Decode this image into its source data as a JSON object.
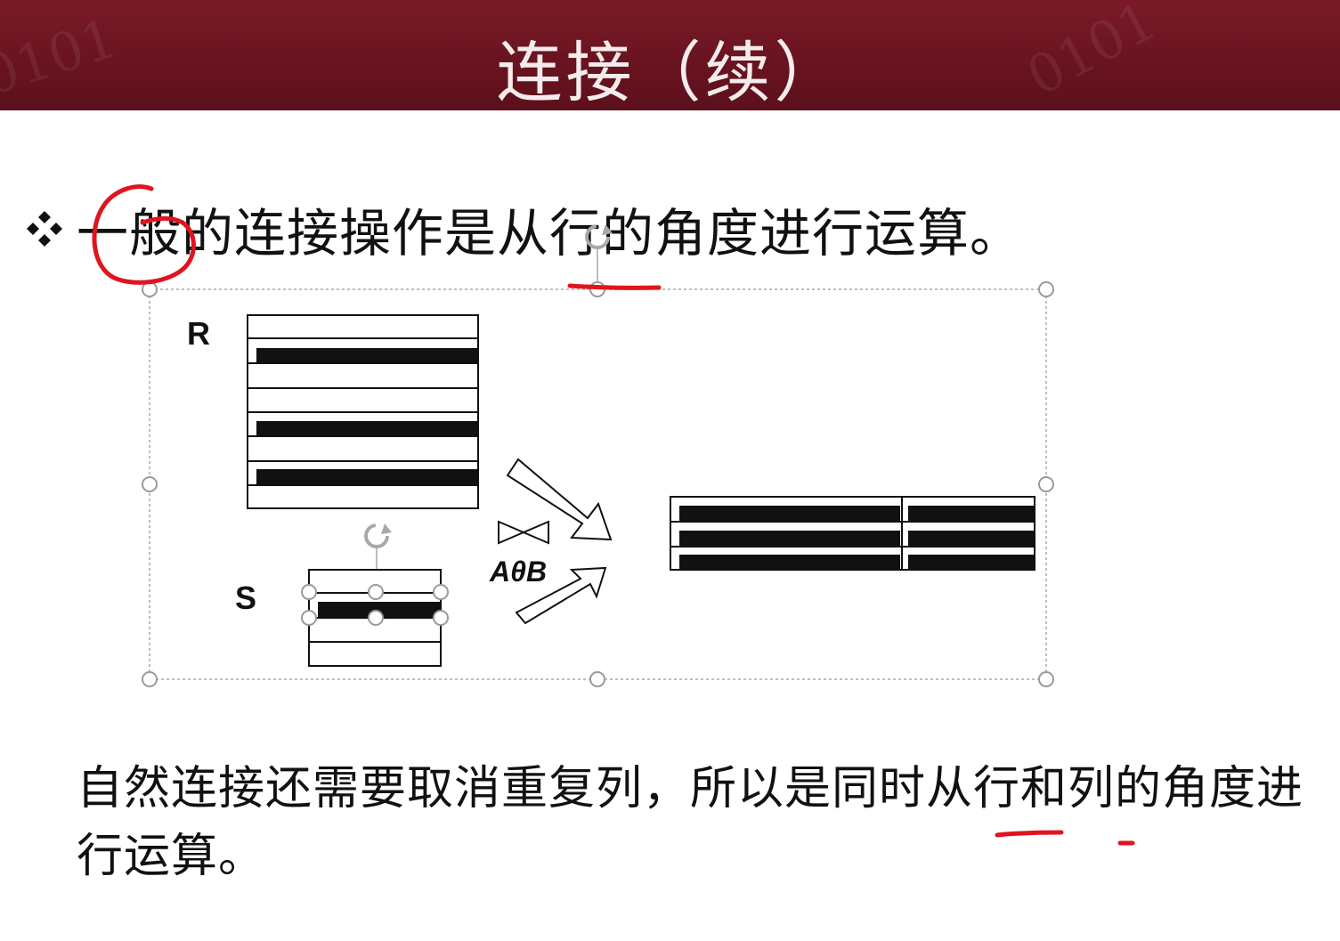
{
  "slide": {
    "title": "连接（续）",
    "header_binary": "0101",
    "bullet_text": "一般的连接操作是从行的角度进行运算。",
    "bottom_text": "自然连接还需要取消重复列，所以是同时从行和列的角度进行运算。"
  },
  "diagram": {
    "relation_r": "R",
    "relation_s": "S",
    "operator_label": "AθB"
  },
  "colors": {
    "header_bg": "#6a1420",
    "title_text": "#f4ecec",
    "annotation_red": "#e0141e",
    "selection_gray": "#a9a9a9"
  }
}
